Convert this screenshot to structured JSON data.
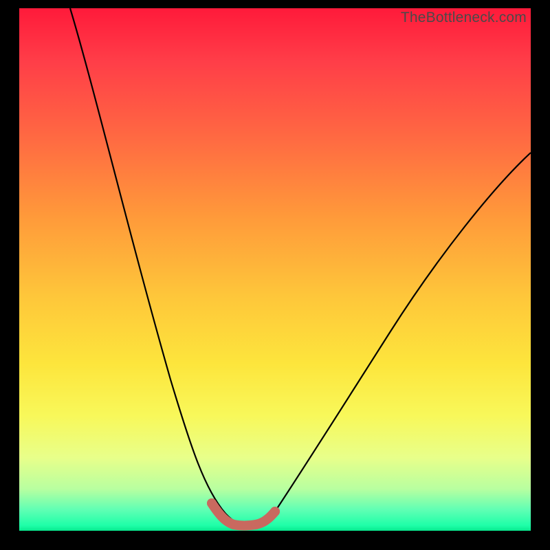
{
  "watermark": "TheBottleneck.com",
  "colors": {
    "frame": "#000000",
    "curve": "#000000",
    "marker": "#c9695f",
    "gradient_top": "#ff1a3a",
    "gradient_mid": "#fde53c",
    "gradient_bottom": "#07e88e"
  },
  "chart_data": {
    "type": "line",
    "title": "",
    "xlabel": "",
    "ylabel": "",
    "xlim": [
      0,
      100
    ],
    "ylim": [
      0,
      100
    ],
    "grid": false,
    "series": [
      {
        "name": "bottleneck-curve",
        "x": [
          10,
          15,
          20,
          25,
          30,
          33,
          36,
          38,
          40,
          42,
          44,
          46,
          48,
          52,
          58,
          65,
          72,
          80,
          88,
          95,
          100
        ],
        "y": [
          100,
          85,
          69,
          53,
          38,
          28,
          19,
          12,
          6,
          2,
          1,
          1,
          2,
          6,
          15,
          25,
          35,
          45,
          55,
          62,
          67
        ]
      }
    ],
    "annotations": [
      {
        "name": "trough-markers",
        "type": "marker-run",
        "description": "thick salmon markers along curve near minimum",
        "x_range": [
          37,
          49
        ],
        "y_approx": 2,
        "color": "#c9695f"
      }
    ]
  }
}
